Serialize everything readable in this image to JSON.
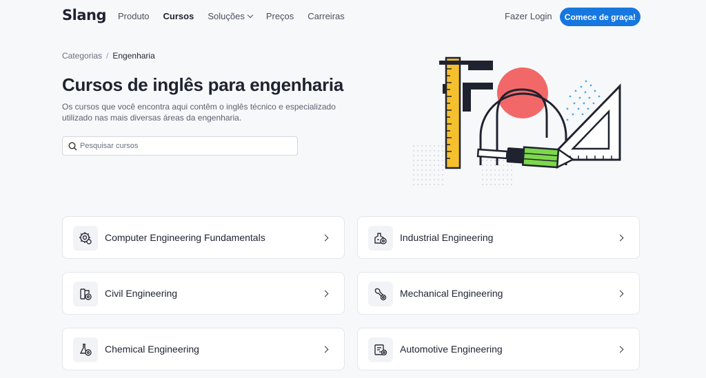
{
  "nav": {
    "logo": "Slang",
    "links": [
      "Produto",
      "Cursos",
      "Soluções",
      "Preços",
      "Carreiras"
    ],
    "login": "Fazer Login",
    "cta": "Comece de graça!"
  },
  "breadcrumb": {
    "root": "Categorias",
    "separator": "/",
    "current": "Engenharia"
  },
  "hero": {
    "title": "Cursos de inglês para engenharia",
    "subtitle_line1": "Os cursos que você encontra aqui contêm o inglês técnico e especializado",
    "subtitle_line2": "utilizado nas mais diversas áreas da engenharia."
  },
  "search": {
    "placeholder": "Pesquisar cursos",
    "value": ""
  },
  "courses": [
    {
      "label": "Computer Engineering Fundamentals",
      "icon": "cog-gear-icon"
    },
    {
      "label": "Industrial Engineering",
      "icon": "industry-gear-icon"
    },
    {
      "label": "Civil Engineering",
      "icon": "crane-gear-icon"
    },
    {
      "label": "Mechanical Engineering",
      "icon": "wrench-gear-icon"
    },
    {
      "label": "Chemical Engineering",
      "icon": "flask-gear-icon"
    },
    {
      "label": "Automotive Engineering",
      "icon": "car-gear-icon"
    }
  ],
  "colors": {
    "accent": "#1677e0",
    "illustration_red": "#f26868",
    "illustration_yellow": "#f5c02e",
    "illustration_green": "#7dd84a",
    "illustration_dots": "#4aa8e8"
  }
}
